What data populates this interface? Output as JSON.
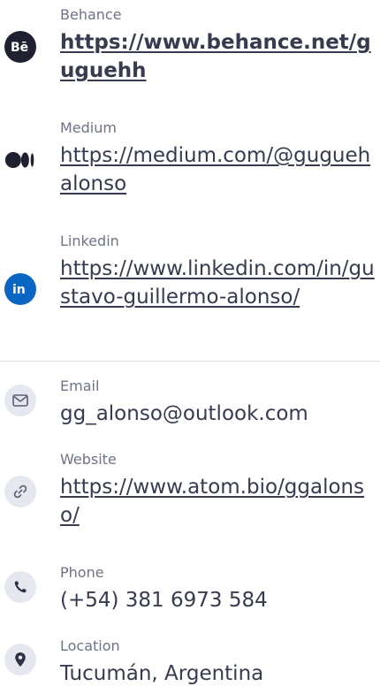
{
  "profiles": [
    {
      "label": "Behance",
      "url": "https://www.behance.net/guguehh",
      "icon": "behance-icon"
    },
    {
      "label": "Medium",
      "url": "https://medium.com/@guguehalonso",
      "icon": "medium-icon"
    },
    {
      "label": "Linkedin",
      "url": "https://www.linkedin.com/in/gustavo-guillermo-alonso/",
      "icon": "linkedin-icon"
    }
  ],
  "contacts": [
    {
      "label": "Email",
      "value": "gg_alonso@outlook.com",
      "icon": "mail-icon"
    },
    {
      "label": "Website",
      "value": "https://www.atom.bio/ggalonso/",
      "icon": "link-icon"
    },
    {
      "label": "Phone",
      "value": "(+54) 381 6973 584",
      "icon": "phone-icon"
    },
    {
      "label": "Location",
      "value": "Tucumán, Argentina",
      "icon": "location-pin-icon"
    }
  ],
  "colors": {
    "text": "#363b4f",
    "label": "#6e7385",
    "icon_dark": "#1f2030",
    "linkedin_blue": "#0a66c2",
    "icon_bg": "#e6e8ef",
    "divider": "#dcdde3"
  }
}
